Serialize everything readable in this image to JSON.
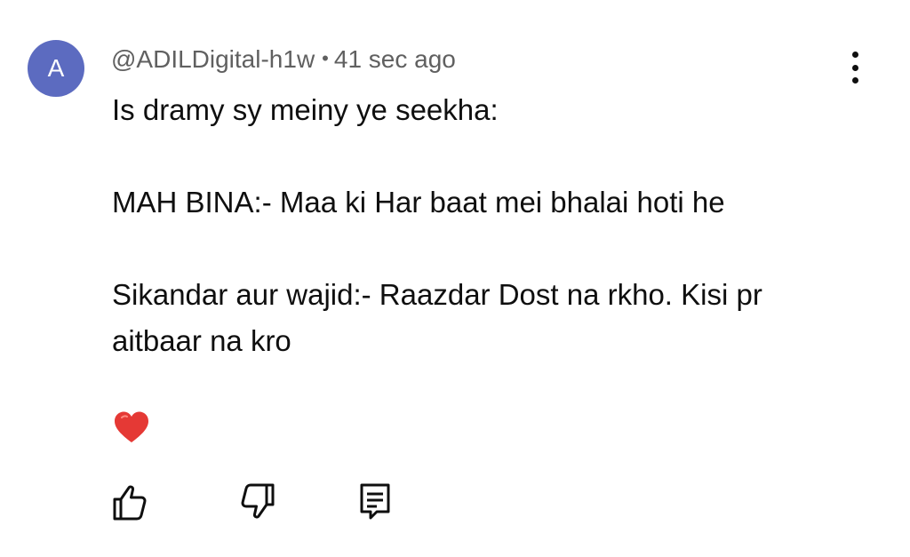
{
  "comment": {
    "avatar_letter": "A",
    "avatar_color": "#5c6bc0",
    "author_handle": "@ADILDigital-h1w",
    "separator": "•",
    "timestamp": "41 sec ago",
    "lines": {
      "line1": "Is dramy sy meiny ye seekha:",
      "line2": "MAH BINA:- Maa ki Har baat mei bhalai hoti he",
      "line3": "Sikandar aur wajid:- Raazdar Dost na rkho. Kisi pr aitbaar na kro"
    },
    "reaction_icon": "red-heart-icon",
    "actions": {
      "like_icon": "thumbs-up-icon",
      "dislike_icon": "thumbs-down-icon",
      "reply_icon": "reply-comment-icon",
      "menu_icon": "more-vert-icon"
    }
  }
}
